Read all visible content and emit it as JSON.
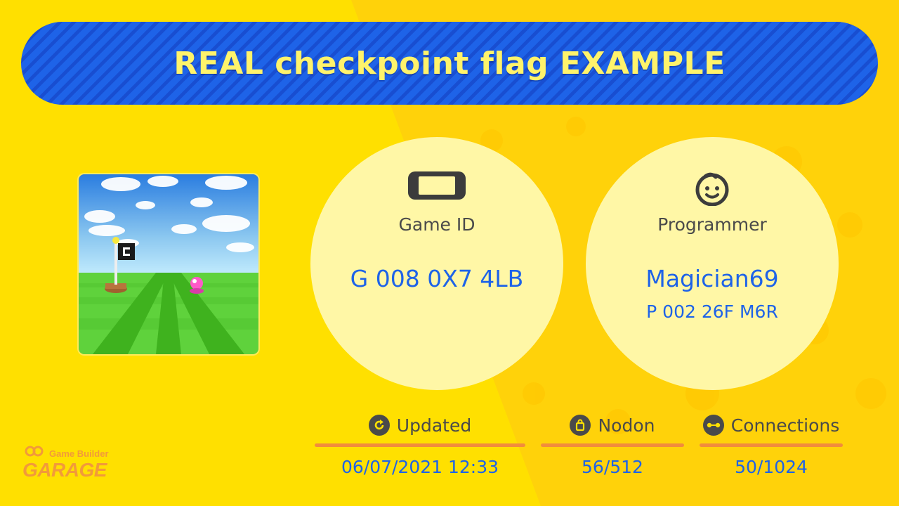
{
  "title": "REAL checkpoint flag EXAMPLE",
  "game_id": {
    "label": "Game ID",
    "value": "G 008 0X7 4LB",
    "icon": "switch-console-icon"
  },
  "programmer": {
    "label": "Programmer",
    "name": "Magician69",
    "id": "P 002 26F M6R",
    "icon": "child-face-icon"
  },
  "stats": {
    "updated": {
      "label": "Updated",
      "value": "06/07/2021 12:33",
      "icon": "refresh-icon"
    },
    "nodon": {
      "label": "Nodon",
      "value": "56/512",
      "icon": "bag-icon"
    },
    "connections": {
      "label": "Connections",
      "value": "50/1024",
      "icon": "connection-icon"
    }
  },
  "logo": {
    "line1": "Game Builder",
    "line2": "GARAGE"
  },
  "colors": {
    "background": "#ffe000",
    "banner": "#1e63e8",
    "title_text": "#fff36b",
    "accent_blue": "#1e63e8",
    "circle": "#fff7a6",
    "bar": "#f28c3c"
  }
}
